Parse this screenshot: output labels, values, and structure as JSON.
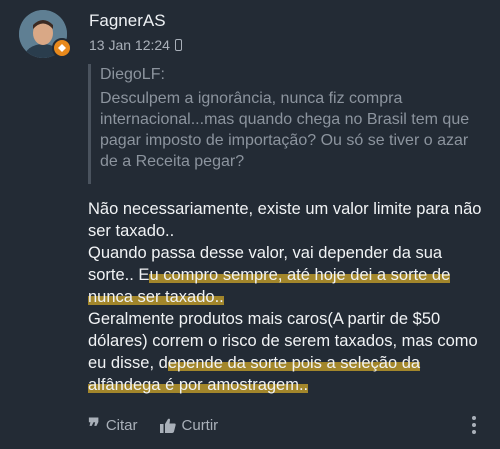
{
  "post": {
    "author": "FagnerAS",
    "timestamp": "13 Jan 12:24",
    "device_icon": "mobile-device-icon",
    "quote": {
      "author": "DiegoLF:",
      "text": "Desculpem a ignorância, nunca fiz compra internacional...mas quando chega no Brasil tem que pagar imposto de importação? Ou só se tiver o azar de a Receita pegar?"
    },
    "body": {
      "p1": "Não necessariamente, existe um valor limite para não ser taxado..",
      "p2_a": "Quando passa desse valor, vai depender da sua sorte.. E",
      "p2_hl": "u compro sempre, até hoje dei a sorte de nunca ser taxado..",
      "p3_a": "Geralmente produtos mais caros(A partir de $50 dólares) correm o risco de serem taxados, mas como eu disse, d",
      "p3_hl": "epende da sorte pois a seleção da alfândega é por amostragem.."
    },
    "actions": {
      "quote_label": "Citar",
      "like_label": "Curtir"
    }
  },
  "colors": {
    "background": "#232b35",
    "highlight": "#cda528",
    "badge": "#e8891c"
  }
}
